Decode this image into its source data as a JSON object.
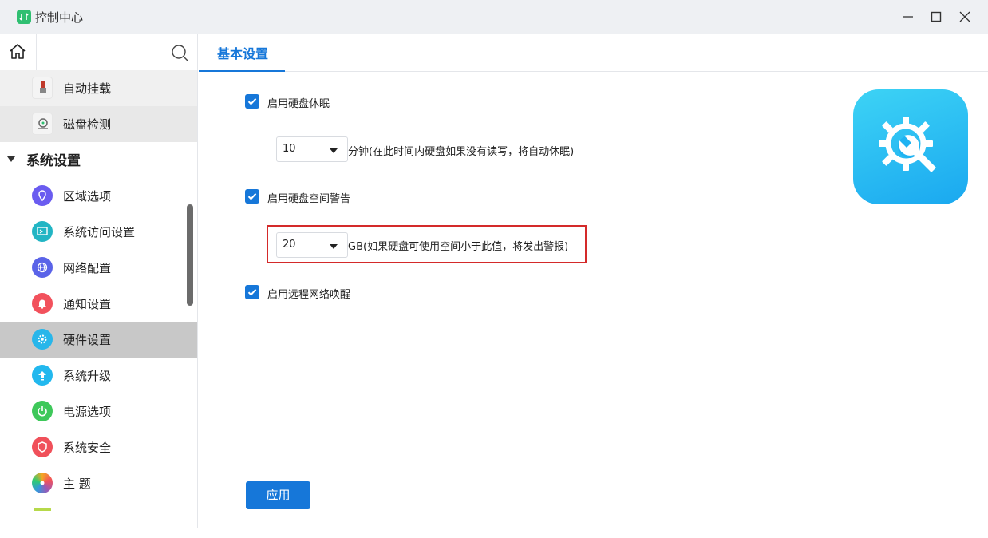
{
  "window": {
    "title": "控制中心",
    "minimize_icon": "minimize-icon",
    "maximize_icon": "maximize-icon",
    "close_icon": "close-icon"
  },
  "sidebar": {
    "home_icon": "home-icon",
    "search_icon": "search-icon",
    "sub_items": [
      {
        "label": "自动挂载",
        "icon": "usb-mount-icon"
      },
      {
        "label": "磁盘检测",
        "icon": "disk-check-icon"
      }
    ],
    "group": {
      "label": "系统设置",
      "expanded": true
    },
    "items": [
      {
        "label": "区域选项",
        "icon": "location-icon",
        "color": "#6a5cf0"
      },
      {
        "label": "系统访问设置",
        "icon": "monitor-icon",
        "color": "#22b5c4"
      },
      {
        "label": "网络配置",
        "icon": "globe-icon",
        "color": "#5a63e8"
      },
      {
        "label": "通知设置",
        "icon": "bell-icon",
        "color": "#f2515c"
      },
      {
        "label": "硬件设置",
        "icon": "hardware-icon",
        "color": "#28b6ea",
        "active": true
      },
      {
        "label": "系统升级",
        "icon": "upgrade-icon",
        "color": "#22b8ee"
      },
      {
        "label": "电源选项",
        "icon": "power-icon",
        "color": "#3ec85a"
      },
      {
        "label": "系统安全",
        "icon": "shield-icon",
        "color": "#f0505a"
      },
      {
        "label": "主 题",
        "icon": "theme-icon",
        "color": "#f5a623"
      }
    ]
  },
  "tabs": [
    {
      "label": "基本设置",
      "active": true
    }
  ],
  "settings": {
    "hdd_sleep": {
      "label": "启用硬盘休眠",
      "checked": true
    },
    "sleep_minutes": {
      "value": "10",
      "hint": "分钟(在此时间内硬盘如果没有读写，将自动休眠)"
    },
    "space_warning": {
      "label": "启用硬盘空间警告",
      "checked": true
    },
    "warning_gb": {
      "value": "20",
      "hint": "GB(如果硬盘可使用空间小于此值，将发出警报)"
    },
    "wake_on_lan": {
      "label": "启用远程网络唤醒",
      "checked": true
    }
  },
  "apply_button": "应用",
  "hero_icon": "settings-gear-wrench-icon",
  "colors": {
    "accent": "#1677d9",
    "highlight": "#d42a2a",
    "hero": "#1aa8f0"
  }
}
